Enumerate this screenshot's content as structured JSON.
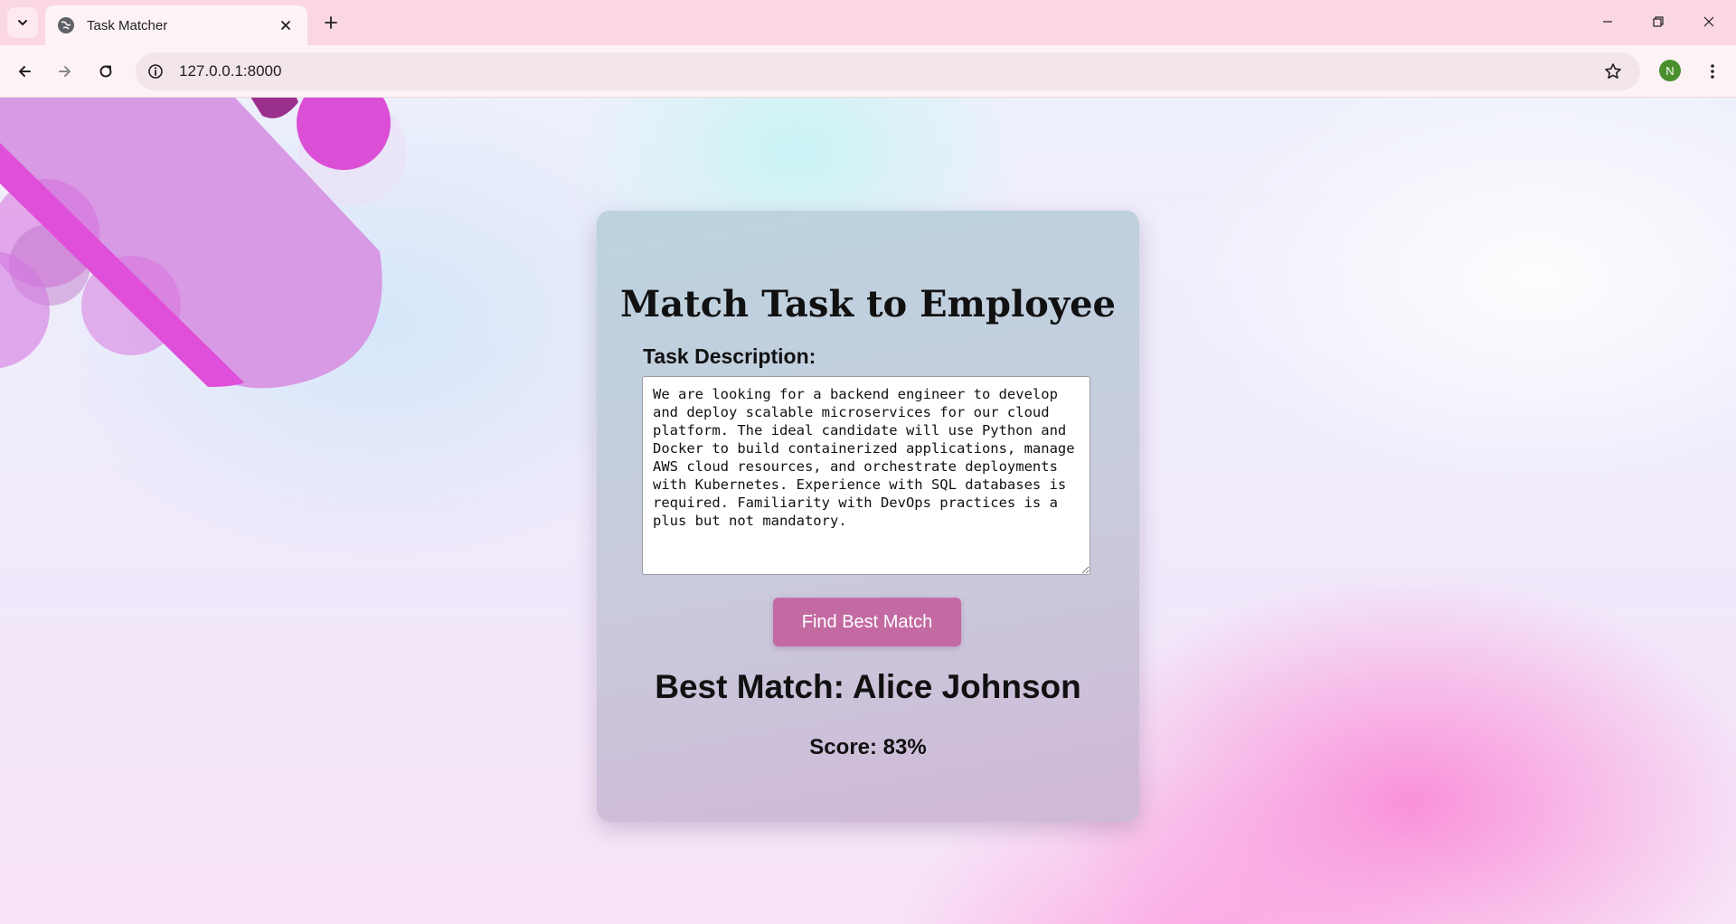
{
  "browser": {
    "tab_title": "Task Matcher",
    "url": "127.0.0.1:8000",
    "profile_initial": "N"
  },
  "page": {
    "title": "Match Task to Employee",
    "task_label": "Task Description:",
    "task_text": "We are looking for a backend engineer to develop and deploy scalable microservices for our cloud platform. The ideal candidate will use Python and Docker to build containerized applications, manage AWS cloud resources, and orchestrate deployments with Kubernetes. Experience with SQL databases is required. Familiarity with DevOps practices is a plus but not mandatory.",
    "find_button_label": "Find Best Match",
    "best_match": "Best Match: Alice Johnson",
    "score": "Score: 83%"
  },
  "colors": {
    "button": "#c46aa3",
    "tabstrip": "#fbd7e1",
    "avatar": "#4a8f2e"
  }
}
